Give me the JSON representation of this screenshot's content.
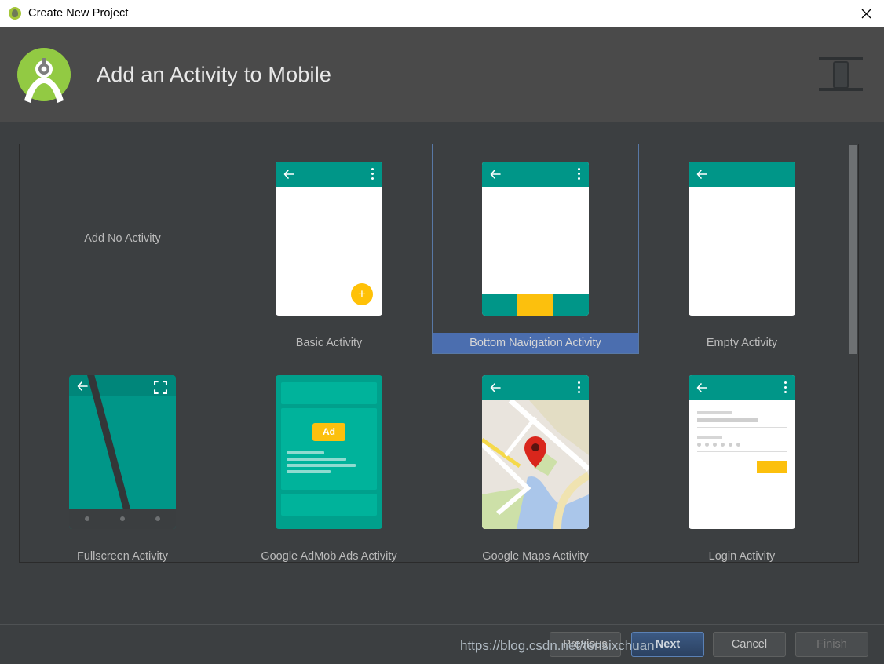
{
  "window": {
    "title": "Create New Project",
    "icon": "android-icon",
    "close_label": "close-icon"
  },
  "header": {
    "title": "Add an Activity to Mobile",
    "logo_icon": "android-studio-logo",
    "device_icon": "mobile-device-icon"
  },
  "gallery": {
    "items": [
      {
        "label": "Add No Activity",
        "thumb": "none",
        "selected": false
      },
      {
        "label": "Basic Activity",
        "thumb": "basic",
        "selected": false
      },
      {
        "label": "Bottom Navigation Activity",
        "thumb": "bottomnav",
        "selected": true
      },
      {
        "label": "Empty Activity",
        "thumb": "empty",
        "selected": false
      },
      {
        "label": "Fullscreen Activity",
        "thumb": "fullscreen",
        "selected": false
      },
      {
        "label": "Google AdMob Ads Activity",
        "thumb": "admob",
        "selected": false
      },
      {
        "label": "Google Maps Activity",
        "thumb": "maps",
        "selected": false
      },
      {
        "label": "Login Activity",
        "thumb": "login",
        "selected": false
      }
    ],
    "admob_badge": "Ad"
  },
  "footer": {
    "previous_label": "Previous",
    "next_label": "Next",
    "cancel_label": "Cancel",
    "finish_label": "Finish"
  },
  "watermark": {
    "text": "https://blog.csdn.net/tensixchuan"
  },
  "colors": {
    "accent_teal": "#009688",
    "accent_yellow": "#fcc00d",
    "selection_blue": "#4b6eaf",
    "header_bg": "#4a4a4a",
    "body_bg": "#3c3f41"
  }
}
